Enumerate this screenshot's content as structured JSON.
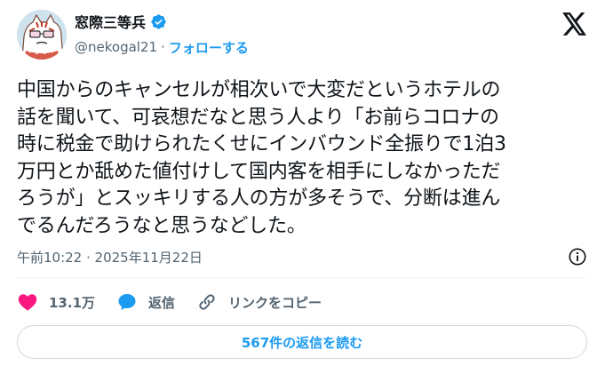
{
  "author": {
    "display_name": "窓際三等兵",
    "handle": "@nekogal21",
    "separator": "·",
    "follow_label": "フォローする",
    "verified": true
  },
  "tweet": {
    "lines": [
      "中国からのキャンセルが相次いで大変だというホテルの",
      "話を聞いて、可哀想だなと思う人より「お前らコロナの",
      "時に税金で助けられたくせにインバウンド全振りで1泊3",
      "万円とか舐めた値付けして国内客を相手にしなかっただ",
      "ろうが」とスッキリする人の方が多そうで、分断は進ん",
      "でるんだろうなと思うなどした。"
    ],
    "timestamp": "午前10:22 · 2025年11月22日"
  },
  "actions": {
    "likes_label": "13.1万",
    "reply_label": "返信",
    "copy_link_label": "リンクをコピー"
  },
  "read_replies_label": "567件の返信を読む",
  "colors": {
    "accent": "#1d9bf0",
    "like": "#f91880",
    "text": "#0f1419",
    "muted": "#536471",
    "border": "#cfd9de"
  },
  "icons": {
    "verified": "verified-badge-icon",
    "platform": "x-logo-icon",
    "info": "info-icon",
    "like": "heart-icon",
    "reply": "speech-bubble-icon",
    "copy_link": "link-icon"
  }
}
